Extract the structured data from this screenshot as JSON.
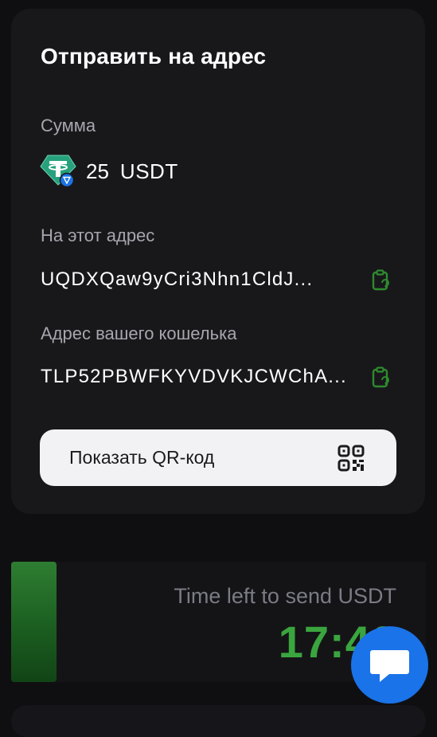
{
  "send_card": {
    "title": "Отправить на адрес",
    "amount_label": "Сумма",
    "amount_value": "25",
    "amount_currency": "USDT",
    "token_icon": "tether-usdt-tron-icon",
    "to_address_label": "На этот адрес",
    "to_address": "UQDXQaw9yCri3Nhn1CldJ...",
    "wallet_address_label": "Адрес вашего кошелька",
    "wallet_address": "TLP52PBWFKYVDVKJCWChA...",
    "copy_icon": "clipboard-copy-icon",
    "qr_button_label": "Показать QR-код",
    "qr_icon": "qr-code-icon"
  },
  "timer": {
    "caption": "Time left to send USDT",
    "value": "17:40"
  },
  "chat": {
    "icon": "chat-bubble-icon"
  },
  "colors": {
    "background": "#0f0f12",
    "card": "#18181b",
    "label": "#a6a6ad",
    "accent_green": "#3aa53e",
    "copy_icon": "#2e8b2e",
    "tether_teal": "#26a17b",
    "tron_blue": "#1a73e8",
    "chat_blue": "#1a73e8",
    "qr_button_bg": "#f2f2f4"
  }
}
